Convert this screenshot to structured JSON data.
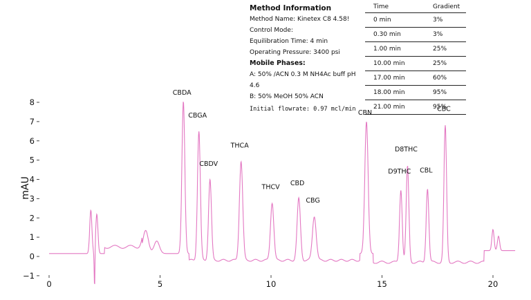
{
  "method": {
    "title": "Method Information",
    "name": "Method Name: Kinetex C8 4.58!",
    "control_mode": "Control Mode:",
    "equilibration": "Equilibration Time: 4 min",
    "pressure": "Operating Pressure: 3400 psi",
    "mobile_title": "Mobile Phases:",
    "phase_a": "A: 50% /ACN 0.3 M NH4Ac buff pH 4.6",
    "phase_b": "B: 50% MeOH 50% ACN",
    "flowrate": "Initial flowrate: 0.97 mcl/min"
  },
  "gradient": {
    "headers": [
      "Time",
      "Gradient"
    ],
    "rows": [
      [
        "0 min",
        "3%"
      ],
      [
        "0.30 min",
        "3%"
      ],
      [
        "1.00 min",
        "25%"
      ],
      [
        "10.00 min",
        "25%"
      ],
      [
        "17.00 min",
        "60%"
      ],
      [
        "18.00 min",
        "95%"
      ],
      [
        "21.00 min",
        "95%"
      ]
    ]
  },
  "chart_data": {
    "type": "line",
    "title": "",
    "xlabel": "",
    "ylabel": "mAU",
    "xlim": [
      0,
      21
    ],
    "ylim": [
      -1,
      8.5
    ],
    "x_ticks": [
      0,
      5,
      10,
      15,
      20
    ],
    "y_ticks": [
      -1,
      0,
      1,
      2,
      3,
      4,
      5,
      6,
      7,
      8
    ],
    "grid": false,
    "line_color": "#e377c2",
    "baseline": 0.15,
    "peaks": [
      {
        "label": "",
        "x": 1.88,
        "y": 2.25,
        "w": 0.05
      },
      {
        "label": "",
        "x": 2.15,
        "y": 2.05,
        "w": 0.05
      },
      {
        "label": "",
        "x": 4.35,
        "y": 1.2,
        "w": 0.12
      },
      {
        "label": "",
        "x": 4.85,
        "y": 0.65,
        "w": 0.12
      },
      {
        "label": "CBDA",
        "x": 6.05,
        "y": 7.9,
        "w": 0.065
      },
      {
        "label": "CBGA",
        "x": 6.75,
        "y": 6.7,
        "w": 0.065
      },
      {
        "label": "CBDV",
        "x": 7.25,
        "y": 4.2,
        "w": 0.065
      },
      {
        "label": "THCA",
        "x": 8.65,
        "y": 5.15,
        "w": 0.075
      },
      {
        "label": "THCV",
        "x": 10.05,
        "y": 3.0,
        "w": 0.075
      },
      {
        "label": "CBD",
        "x": 11.25,
        "y": 3.2,
        "w": 0.075
      },
      {
        "label": "CBG",
        "x": 11.95,
        "y": 2.3,
        "w": 0.085
      },
      {
        "label": "CBN",
        "x": 14.3,
        "y": 6.85,
        "w": 0.075
      },
      {
        "label": "D9THC",
        "x": 15.85,
        "y": 3.8,
        "w": 0.06
      },
      {
        "label": "D8THC",
        "x": 16.15,
        "y": 4.95,
        "w": 0.06
      },
      {
        "label": "CBL",
        "x": 17.05,
        "y": 3.85,
        "w": 0.06
      },
      {
        "label": "CBC",
        "x": 17.85,
        "y": 7.05,
        "w": 0.06
      },
      {
        "label": "",
        "x": 20.0,
        "y": 1.1,
        "w": 0.05
      },
      {
        "label": "",
        "x": 20.25,
        "y": 0.75,
        "w": 0.05
      }
    ]
  }
}
